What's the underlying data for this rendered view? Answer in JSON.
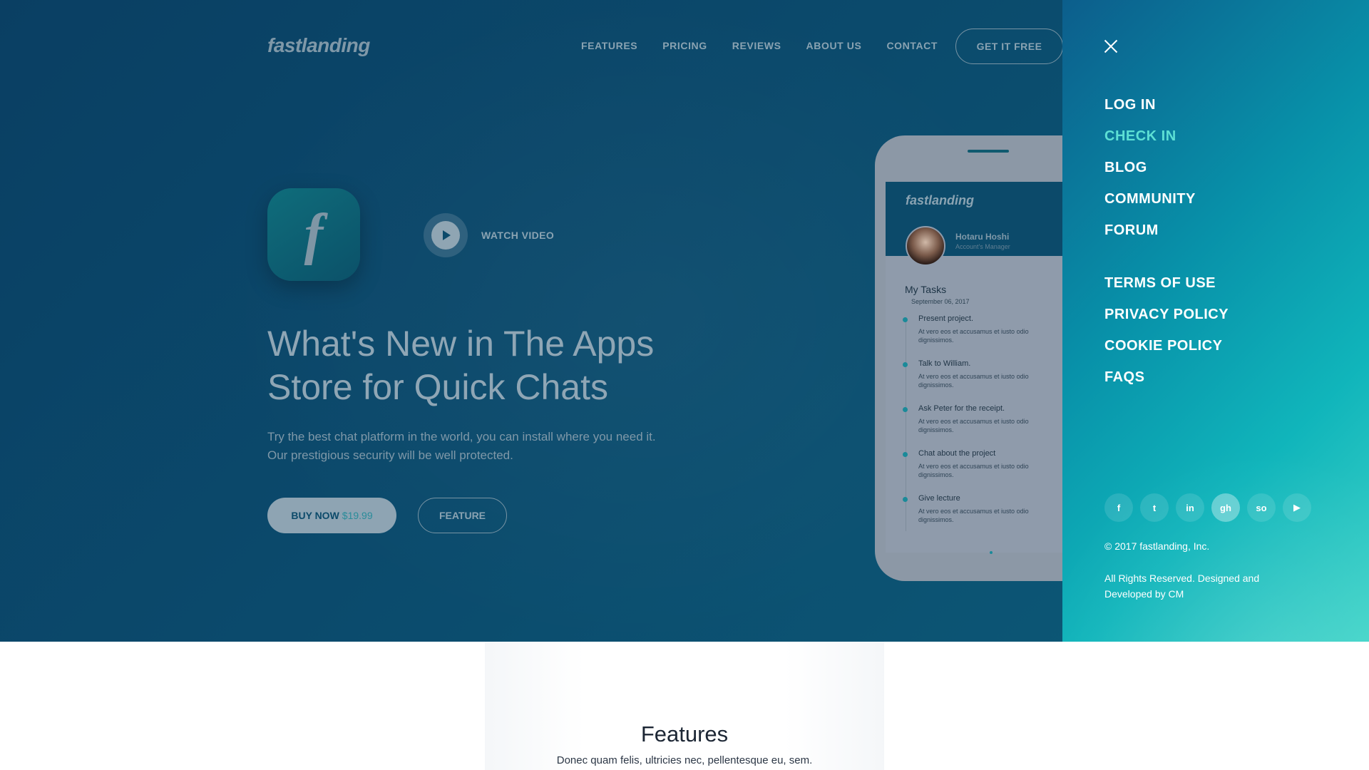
{
  "header": {
    "logo": "fastlanding",
    "nav": [
      "FEATURES",
      "PRICING",
      "REVIEWS",
      "ABOUT US",
      "CONTACT"
    ],
    "cta": "GET IT FREE"
  },
  "hero": {
    "app_icon_letter": "f",
    "watch_video": "WATCH VIDEO",
    "headline_line1": "What's New in The Apps",
    "headline_line2": "Store for Quick Chats",
    "subtext_line1": "Try the best chat platform in the world, you can install where you need it.",
    "subtext_line2": "Our prestigious security will be well protected.",
    "buy_label": "BUY NOW",
    "buy_price": "$19.99",
    "feature_label": "FEATURE"
  },
  "phone": {
    "logo": "fastlanding",
    "menu_icon": "≡",
    "user_name": "Hotaru Hoshi",
    "user_role": "Account's Manager",
    "tasks_title": "My Tasks",
    "tasks_date": "September 06, 2017",
    "tasks": [
      {
        "title": "Present project.",
        "desc": "At vero eos et accusamus et iusto odio dignissimos."
      },
      {
        "title": "Talk to William.",
        "desc": "At vero eos et accusamus et iusto odio dignissimos."
      },
      {
        "title": "Ask Peter for the receipt.",
        "desc": "At vero eos et accusamus et iusto odio dignissimos."
      },
      {
        "title": "Chat about the project",
        "desc": "At vero eos et accusamus et iusto odio dignissimos."
      },
      {
        "title": "Give lecture",
        "desc": "At vero eos et accusamus et iusto odio dignissimos."
      }
    ]
  },
  "side_menu": {
    "primary": [
      "LOG IN",
      "CHECK IN",
      "BLOG",
      "COMMUNITY",
      "FORUM"
    ],
    "active_item": "CHECK IN",
    "secondary": [
      "TERMS OF USE",
      "PRIVACY POLICY",
      "COOKIE POLICY",
      "FAQS"
    ],
    "social_icons": [
      "facebook-icon",
      "twitter-icon",
      "linkedin-icon",
      "github-icon",
      "stackoverflow-icon",
      "youtube-icon"
    ],
    "social_glyphs": [
      "f",
      "t",
      "in",
      "gh",
      "so",
      "▶"
    ],
    "copyright": "© 2017 fastlanding, Inc.",
    "rights": "All Rights Reserved. Designed and Developed by CM"
  },
  "features": {
    "title": "Features",
    "subtitle": "Donec quam felis, ultricies nec, pellentesque eu, sem."
  },
  "colors": {
    "hero_bg": "#0b4a6c",
    "side_menu_accent": "#10b5bb",
    "active_menu": "#5de0d4"
  }
}
